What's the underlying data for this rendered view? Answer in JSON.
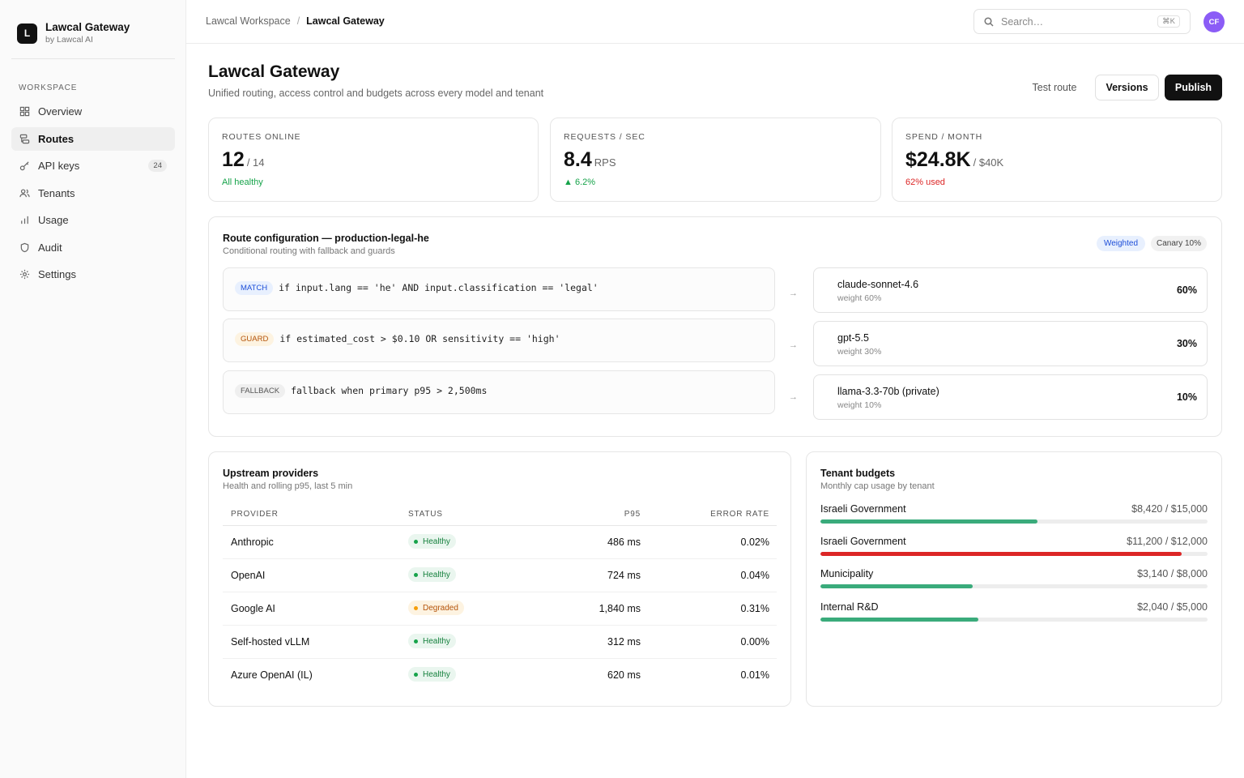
{
  "brand": {
    "logo": "L",
    "name": "Lawcal Gateway",
    "sub": "by Lawcal AI"
  },
  "sidebar": {
    "section": "WORKSPACE",
    "items": [
      {
        "label": "Overview",
        "icon": "grid-icon"
      },
      {
        "label": "Routes",
        "icon": "routes-icon",
        "active": true
      },
      {
        "label": "API keys",
        "icon": "key-icon",
        "badge": "24"
      },
      {
        "label": "Tenants",
        "icon": "users-icon"
      },
      {
        "label": "Usage",
        "icon": "bar-chart-icon"
      },
      {
        "label": "Audit",
        "icon": "shield-icon"
      },
      {
        "label": "Settings",
        "icon": "gear-icon"
      }
    ]
  },
  "topbar": {
    "crumb_root": "Lawcal Workspace",
    "crumb_sep": "/",
    "crumb_current": "Lawcal Gateway",
    "search_placeholder": "Search…",
    "search_kbd": "⌘K",
    "avatar_initials": "CF"
  },
  "header": {
    "title": "Lawcal Gateway",
    "subtitle": "Unified routing, access control and budgets across every model and tenant",
    "test_label": "Test route",
    "versions_label": "Versions",
    "publish_label": "Publish"
  },
  "stats": [
    {
      "label": "ROUTES ONLINE",
      "value": "12",
      "unit": "/ 14",
      "note": "All healthy",
      "note_color": "#16a34a"
    },
    {
      "label": "REQUESTS / SEC",
      "value": "8.4",
      "unit": "RPS",
      "note": "▲ 6.2%",
      "note_color": "#16a34a"
    },
    {
      "label": "SPEND / MONTH",
      "value": "$24.8K",
      "unit": "/ $40K",
      "note": "62% used",
      "note_color": "#dc2626"
    }
  ],
  "route": {
    "title": "Route configuration — production-legal-he",
    "subtitle": "Conditional routing with fallback and guards",
    "tag_weighted": "Weighted",
    "tag_canary": "Canary 10%",
    "arrow": "→",
    "rules": [
      {
        "kind": "MATCH",
        "code": "if input.lang == 'he' AND input.classification == 'legal'"
      },
      {
        "kind": "GUARD",
        "code": "if estimated_cost > $0.10 OR sensitivity == 'high'"
      },
      {
        "kind": "FALLBACK",
        "code": "fallback when primary p95 > 2,500ms"
      }
    ],
    "targets": [
      {
        "name": "claude-sonnet-4.6",
        "weight": "weight 60%",
        "pct": "60%"
      },
      {
        "name": "gpt-5.5",
        "weight": "weight 30%",
        "pct": "30%"
      },
      {
        "name": "llama-3.3-70b (private)",
        "weight": "weight 10%",
        "pct": "10%"
      }
    ]
  },
  "providers": {
    "title": "Upstream providers",
    "subtitle": "Health and rolling p95, last 5 min",
    "columns": {
      "provider": "PROVIDER",
      "status": "STATUS",
      "p95": "P95",
      "error": "ERROR RATE"
    },
    "rows": [
      {
        "provider": "Anthropic",
        "status": "Healthy",
        "kind": "healthy",
        "p95": "486 ms",
        "error": "0.02%"
      },
      {
        "provider": "OpenAI",
        "status": "Healthy",
        "kind": "healthy",
        "p95": "724 ms",
        "error": "0.04%"
      },
      {
        "provider": "Google AI",
        "status": "Degraded",
        "kind": "degraded",
        "p95": "1,840 ms",
        "error": "0.31%"
      },
      {
        "provider": "Self-hosted vLLM",
        "status": "Healthy",
        "kind": "healthy",
        "p95": "312 ms",
        "error": "0.00%"
      },
      {
        "provider": "Azure OpenAI (IL)",
        "status": "Healthy",
        "kind": "healthy",
        "p95": "620 ms",
        "error": "0.01%"
      }
    ]
  },
  "budgets": {
    "title": "Tenant budgets",
    "subtitle": "Monthly cap usage by tenant",
    "items": [
      {
        "name": "Israeli Government",
        "amount": "$8,420 / $15,000",
        "fraction": 0.561,
        "color": "#3aab7b"
      },
      {
        "name": "Israeli Government",
        "amount": "$11,200 / $12,000",
        "fraction": 0.933,
        "color": "#dc2626"
      },
      {
        "name": "Municipality",
        "amount": "$3,140 / $8,000",
        "fraction": 0.3925,
        "color": "#3aab7b"
      },
      {
        "name": "Internal R&D",
        "amount": "$2,040 / $5,000",
        "fraction": 0.408,
        "color": "#3aab7b"
      }
    ]
  }
}
